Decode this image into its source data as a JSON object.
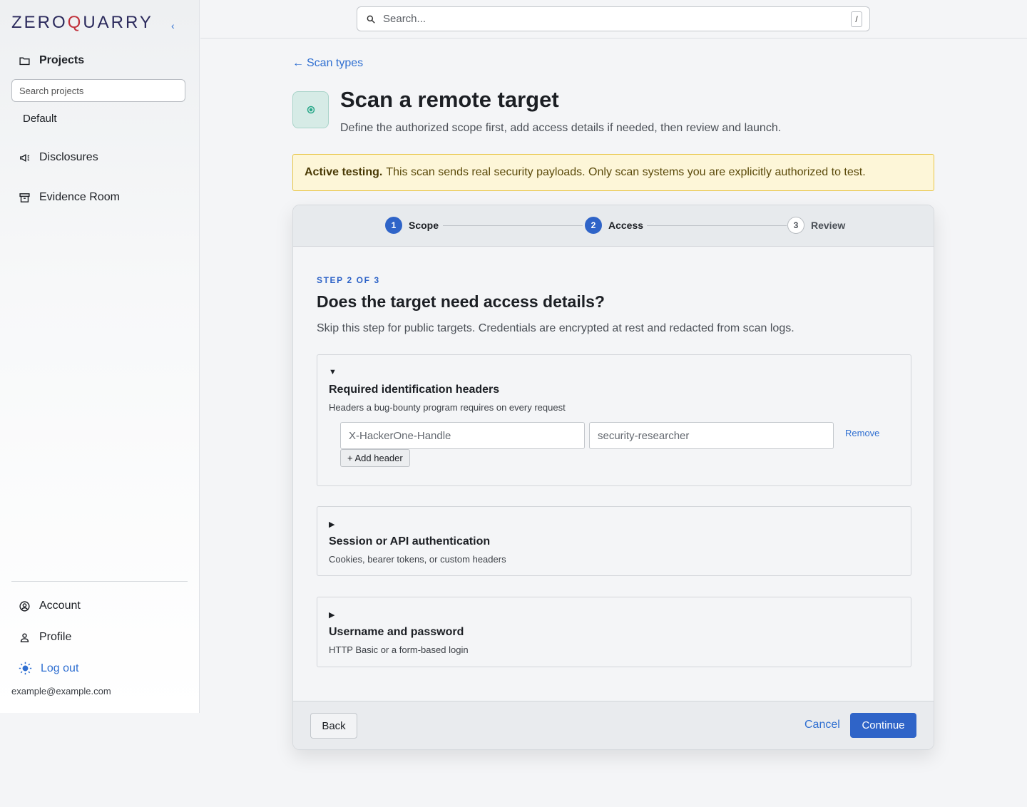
{
  "sidebar": {
    "logo": {
      "prefix": "ZERO",
      "highlight": "Q",
      "suffix": "UARRY"
    },
    "collapse_glyph": "‹",
    "projects_label": "Projects",
    "project_search_placeholder": "Search projects",
    "projects": [
      "Default"
    ],
    "disclosures_label": "Disclosures",
    "evidence_label": "Evidence Room",
    "account_label": "Account",
    "profile_label": "Profile",
    "logout_label": "Log out",
    "user_email": "example@example.com"
  },
  "topbar": {
    "search_placeholder": "Search...",
    "shortcut": "/"
  },
  "page": {
    "back_label": "Scan types",
    "title": "Scan a remote target",
    "subtitle": "Define the authorized scope first, add access details if needed, then review and launch."
  },
  "warning": {
    "bold": "Active testing.",
    "text": "This scan sends real security payloads. Only scan systems you are explicitly authorized to test."
  },
  "wizard": {
    "steps": [
      {
        "num": "1",
        "label": "Scope"
      },
      {
        "num": "2",
        "label": "Access"
      },
      {
        "num": "3",
        "label": "Review"
      }
    ],
    "current_step": 2,
    "kicker": "STEP 2 OF 3",
    "heading": "Does the target need access details?",
    "description": "Skip this step for public targets. Credentials are encrypted at rest and redacted from scan logs.",
    "panels": {
      "headers": {
        "toggle": "▼",
        "title": "Required identification headers",
        "desc": "Headers a bug-bounty program requires on every request",
        "name_placeholder": "X-HackerOne-Handle",
        "value_placeholder": "security-researcher",
        "remove_label": "Remove",
        "add_label": "+ Add header"
      },
      "session": {
        "toggle": "▶",
        "title": "Session or API authentication",
        "desc": "Cookies, bearer tokens, or custom headers"
      },
      "userpass": {
        "toggle": "▶",
        "title": "Username and password",
        "desc": "HTTP Basic or a form-based login"
      }
    },
    "footer": {
      "back_label": "Back",
      "cancel_label": "Cancel",
      "continue_label": "Continue"
    }
  },
  "colors": {
    "accent": "#2f64c8",
    "link": "#2f6fd1",
    "warning_bg": "#fdf6d8",
    "warning_border": "#e8c64a"
  }
}
